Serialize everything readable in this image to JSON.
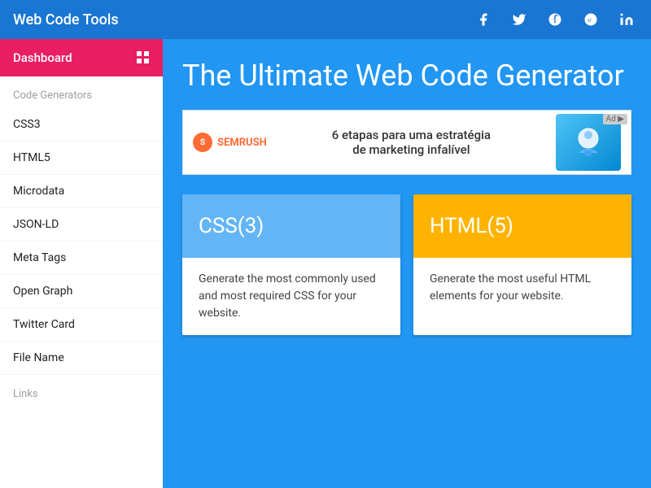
{
  "brand": "Web Code Tools",
  "social_icons": [
    {
      "name": "facebook-icon",
      "symbol": "f"
    },
    {
      "name": "twitter-icon",
      "symbol": "t"
    },
    {
      "name": "google-plus-icon",
      "symbol": "g+"
    },
    {
      "name": "reddit-icon",
      "symbol": "r"
    },
    {
      "name": "linkedin-icon",
      "symbol": "in"
    }
  ],
  "sidebar": {
    "dashboard_label": "Dashboard",
    "code_generators_header": "Code Generators",
    "items": [
      {
        "label": "CSS3",
        "id": "css3"
      },
      {
        "label": "HTML5",
        "id": "html5"
      },
      {
        "label": "Microdata",
        "id": "microdata"
      },
      {
        "label": "JSON-LD",
        "id": "json-ld"
      },
      {
        "label": "Meta Tags",
        "id": "meta-tags"
      },
      {
        "label": "Open Graph",
        "id": "open-graph"
      },
      {
        "label": "Twitter Card",
        "id": "twitter-card"
      },
      {
        "label": "File Name",
        "id": "file-name"
      }
    ],
    "links_header": "Links"
  },
  "main": {
    "title": "The Ultimate Web Code Generator",
    "ad": {
      "logo_text": "SEMRUSH",
      "text_line1": "6 etapas para uma estratégia",
      "text_line2": "de marketing infalível",
      "badge": "Ad ▶"
    },
    "cards": [
      {
        "id": "css3-card",
        "header_label": "CSS(3)",
        "header_class": "css",
        "description": "Generate the most commonly used and most required CSS for your website."
      },
      {
        "id": "html5-card",
        "header_label": "HTML(5)",
        "header_class": "html",
        "description": "Generate the most useful HTML elements for your website."
      }
    ]
  }
}
